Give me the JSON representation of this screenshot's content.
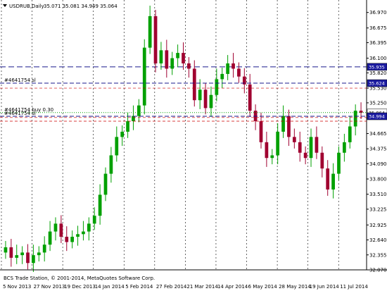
{
  "symbol": {
    "title": "USDRUB,Daily",
    "ohlc": "35.071 35.081 34.949 35.064",
    "menu_icon": "triangle-down-icon"
  },
  "copyright": "BCS Trade Station, © 2001-2014, MetaQuotes Software Corp.",
  "colors": {
    "background": "#ffffff",
    "bull": "#00a000",
    "bear": "#a00030",
    "grid": "#000000",
    "order_line": "#0000cc",
    "sl_line": "#cc0000",
    "level_blue": "#1a1a8c",
    "price_tag": "#ffffff",
    "blue_tag_bg": "#1a1aa0",
    "purple_line": "#9999ee"
  },
  "orders": [
    {
      "label": "#4641754 sl",
      "price_label": "35.624"
    },
    {
      "label": "#4641754 buy 0.30",
      "price_label": "35.064"
    },
    {
      "label": "#4641754 sl",
      "price_label": "34.994"
    }
  ],
  "levels": [
    {
      "price_label": "35.935"
    }
  ],
  "axis": {
    "y_ticks": [
      "36.970",
      "36.675",
      "36.395",
      "36.100",
      "35.820",
      "35.530",
      "35.250",
      "34.960",
      "34.665",
      "34.375",
      "34.090",
      "33.800",
      "33.510",
      "33.225",
      "32.925",
      "32.640",
      "32.355",
      "32.070"
    ],
    "x_ticks": [
      "5 Nov 2013",
      "27 Nov 2013",
      "19 Dec 2013",
      "14 Jan 2014",
      "5 Feb 2014",
      "27 Feb 2014",
      "21 Mar 2014",
      "14 Apr 2014",
      "6 May 2014",
      "28 May 2014",
      "19 Jun 2014",
      "11 Jul 2014"
    ]
  },
  "price_labels_current": "35.064",
  "chart_data": {
    "type": "candlestick",
    "symbol": "USDRUB",
    "timeframe": "Daily",
    "ylim": [
      32.07,
      37.1
    ],
    "x_categories": [
      "5 Nov 2013",
      "27 Nov 2013",
      "19 Dec 2013",
      "14 Jan 2014",
      "5 Feb 2014",
      "27 Feb 2014",
      "21 Mar 2014",
      "14 Apr 2014",
      "6 May 2014",
      "28 May 2014",
      "19 Jun 2014",
      "11 Jul 2014"
    ],
    "horizontal_levels": [
      35.935,
      35.624,
      35.064,
      34.994
    ],
    "close_series": [
      32.5,
      32.3,
      32.35,
      32.4,
      32.2,
      32.35,
      32.4,
      32.55,
      32.8,
      32.95,
      32.7,
      32.6,
      32.7,
      32.75,
      32.8,
      32.95,
      33.1,
      33.5,
      33.9,
      34.25,
      34.6,
      34.7,
      34.9,
      35.0,
      35.2,
      36.3,
      36.9,
      36.0,
      36.25,
      35.9,
      36.1,
      36.2,
      36.0,
      35.9,
      35.3,
      35.5,
      35.15,
      35.4,
      35.7,
      35.8,
      36.0,
      35.9,
      35.75,
      35.6,
      35.1,
      34.9,
      34.5,
      34.2,
      34.25,
      34.7,
      35.0,
      34.6,
      34.5,
      34.3,
      34.2,
      34.6,
      34.3,
      34.0,
      33.6,
      33.9,
      34.3,
      34.5,
      34.8,
      35.1,
      35.06
    ]
  }
}
